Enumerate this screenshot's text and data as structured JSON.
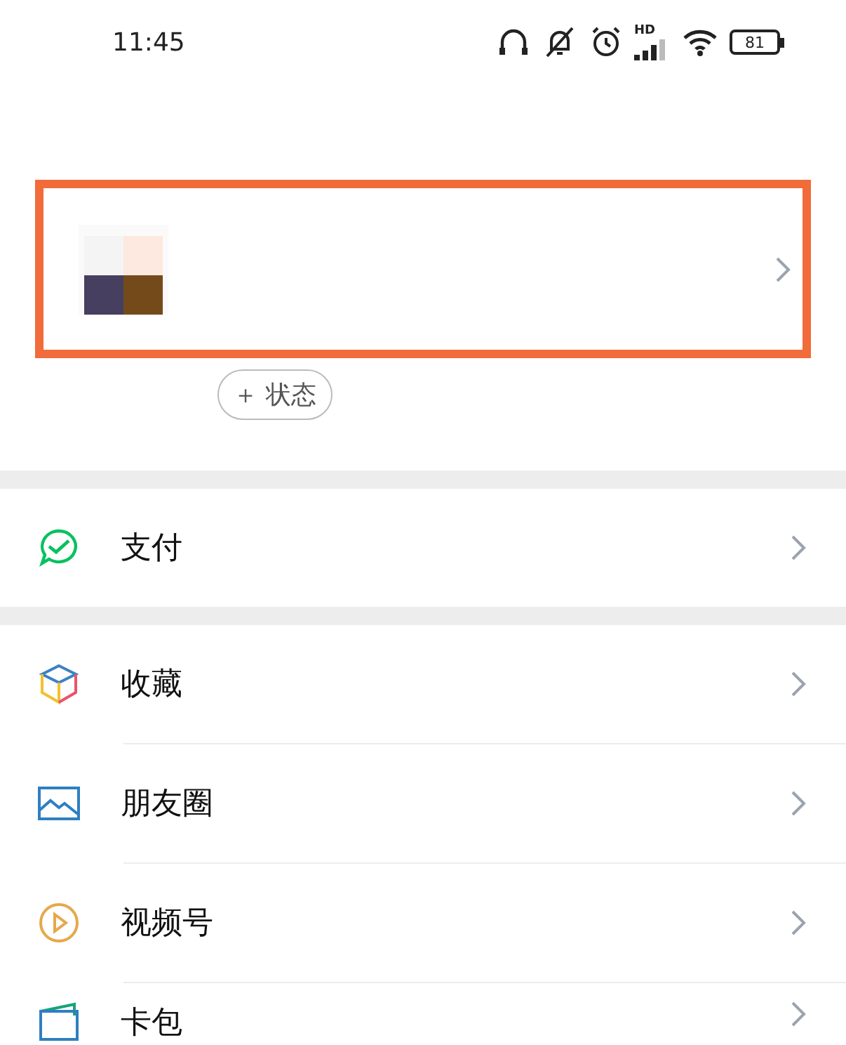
{
  "status_bar": {
    "time": "11:45",
    "network_label": "HD",
    "battery": "81"
  },
  "profile": {
    "highlighted": true
  },
  "status_button": {
    "label": "＋ 状态"
  },
  "menu_groups": [
    {
      "items": [
        {
          "label": "支付",
          "kind": "pay"
        }
      ]
    },
    {
      "items": [
        {
          "label": "收藏",
          "kind": "favorites"
        },
        {
          "label": "朋友圈",
          "kind": "moments"
        },
        {
          "label": "视频号",
          "kind": "channels"
        },
        {
          "label": "卡包",
          "kind": "cards"
        }
      ]
    }
  ]
}
